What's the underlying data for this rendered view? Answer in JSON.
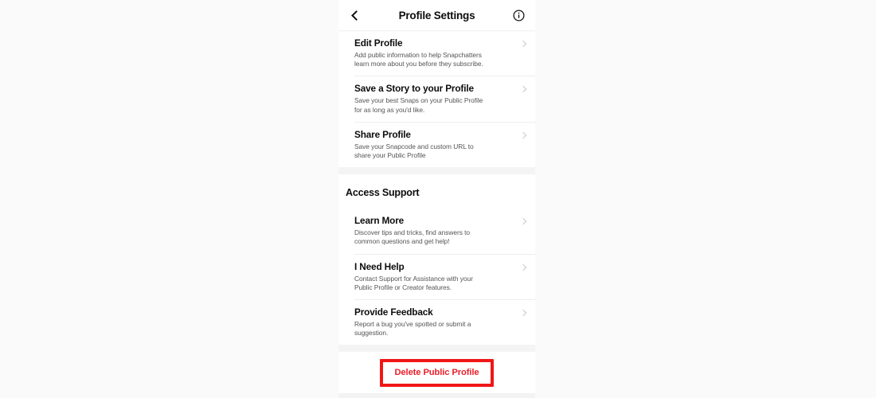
{
  "header": {
    "title": "Profile Settings",
    "back_icon": "chevron-left-icon",
    "info_icon": "info-circle-icon"
  },
  "sections": [
    {
      "id": "profile-section",
      "heading": null,
      "items": [
        {
          "title": "Edit Profile",
          "description": "Add public information to help Snapchatters learn more about you before they subscribe.",
          "chevron": "chevron-right-icon"
        },
        {
          "title": "Save a Story to your Profile",
          "description": "Save your best Snaps on your Public Profile for as long as you'd like.",
          "chevron": "chevron-right-icon"
        },
        {
          "title": "Share Profile",
          "description": "Save your Snapcode and custom URL to share your Public Profile",
          "chevron": "chevron-right-icon"
        }
      ]
    },
    {
      "id": "access-support-section",
      "heading": "Access Support",
      "items": [
        {
          "title": "Learn More",
          "description": "Discover tips and tricks, find answers to common questions and get help!",
          "chevron": "chevron-right-icon"
        },
        {
          "title": "I Need Help",
          "description": "Contact Support for Assistance with your Public Profile or Creator features.",
          "chevron": "chevron-right-icon"
        },
        {
          "title": "Provide Feedback",
          "description": "Report a bug you've spotted or submit a suggestion.",
          "chevron": "chevron-right-icon"
        }
      ]
    }
  ],
  "delete": {
    "label": "Delete Public Profile",
    "text_color": "#e8202a",
    "highlight_color": "#f01717"
  }
}
